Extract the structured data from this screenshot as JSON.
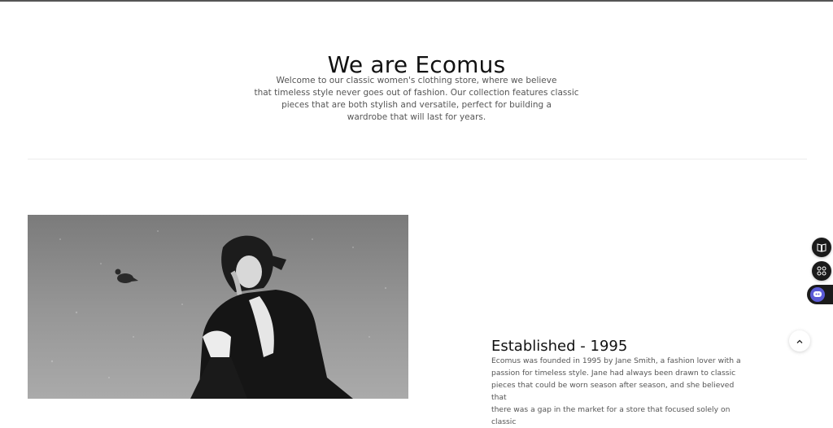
{
  "hero": {
    "title": "We are Ecomus",
    "lines": [
      "Welcome to our classic women's clothing store, where we believe",
      "that timeless style never goes out of fashion. Our collection features classic",
      "pieces that are both stylish and versatile, perfect for building a",
      "wardrobe that will last for years."
    ]
  },
  "story": {
    "title": "Established - 1995",
    "lines": [
      "Ecomus was founded in 1995 by Jane Smith, a fashion lover with a",
      "passion for timeless style. Jane had always been drawn to classic",
      "pieces that could be worn season after season, and she believed that",
      "there was a gap in the market for a store that focused solely on classic"
    ]
  },
  "floating": {
    "icons": [
      "book-icon",
      "command-icon",
      "chat-icon",
      "chevron-up-icon"
    ]
  },
  "colors": {
    "accent": "#1b1b1b",
    "chat": "#5b5bd6"
  }
}
